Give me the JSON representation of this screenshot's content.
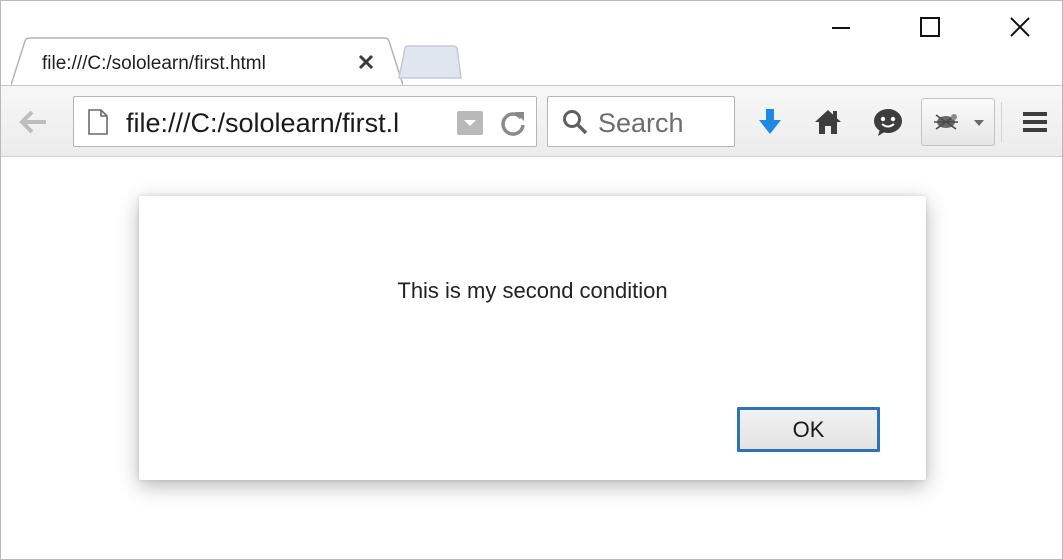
{
  "window": {
    "controls": {
      "minimize_icon": "minimize-icon",
      "maximize_icon": "maximize-icon",
      "close_icon": "close-icon"
    }
  },
  "tabs": [
    {
      "title": "file:///C:/sololearn/first.html",
      "close_icon": "close-icon",
      "active": true
    }
  ],
  "toolbar": {
    "back_icon": "arrow-left-icon",
    "url": "file:///C:/sololearn/first.l",
    "page_icon": "document-icon",
    "dropdown_icon": "chevron-down-icon",
    "reload_icon": "reload-icon",
    "search_placeholder": "Search",
    "search_icon": "magnifier-icon",
    "icons": [
      "download-icon",
      "home-icon",
      "chat-icon",
      "extension-icon",
      "menu-icon"
    ],
    "accent_color": "#1e88e5"
  },
  "dialog": {
    "message": "This is my second condition",
    "ok_label": "OK",
    "button_border_color": "#2f73b6"
  }
}
